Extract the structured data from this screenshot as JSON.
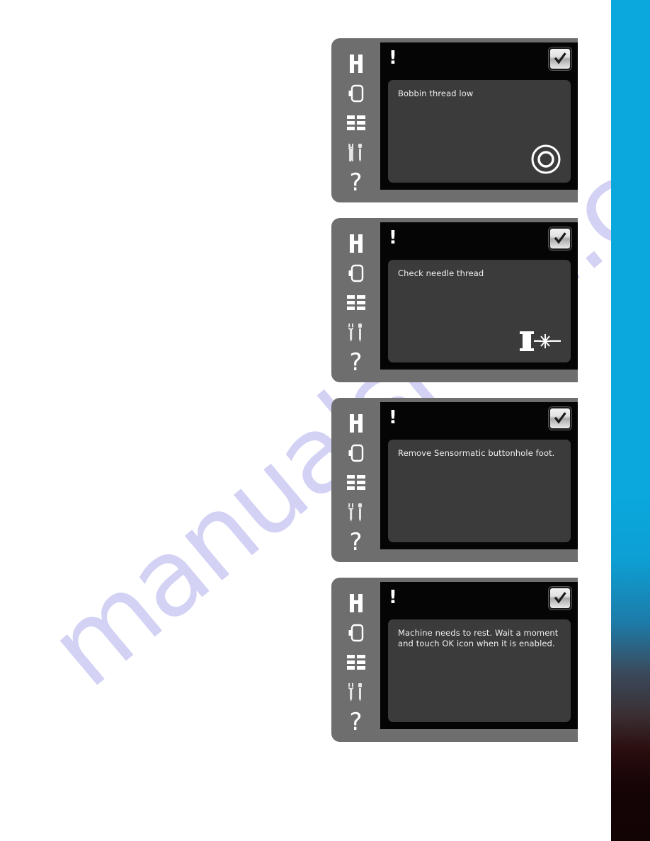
{
  "page": {
    "background_color": "#ffffff",
    "watermark_text": "manualshive.com",
    "watermark_color": "#b9b6ee"
  },
  "edge_strip": {
    "name": "page-edge-gradient",
    "top_color": "#0aa8dd",
    "mid_color": "#3a4a5c",
    "bottom_color": "#160406"
  },
  "sidebar": {
    "items": [
      {
        "icon": "presser-foot-icon",
        "label": ""
      },
      {
        "icon": "bobbin-case-icon",
        "label": ""
      },
      {
        "icon": "menu-grid-icon",
        "label": ""
      },
      {
        "icon": "tools-wrench-screwdriver-icon",
        "label": ""
      },
      {
        "icon": "help-question-mark-icon",
        "label": "?"
      }
    ]
  },
  "common": {
    "alert_marker": "!",
    "ok_button_label": "OK",
    "ok_icon": "checkmark-icon",
    "screen_background": "#050505",
    "message_box_background": "#3b3b3b",
    "panel_background": "#6e6e6e"
  },
  "panels": [
    {
      "id": "popup-bobbin-thread-low",
      "alert": "!",
      "message": "Bobbin thread low",
      "graphic": "bobbin-icon"
    },
    {
      "id": "popup-check-needle-thread",
      "alert": "!",
      "message": "Check needle thread",
      "graphic": "broken-needle-thread-icon"
    },
    {
      "id": "popup-remove-sensormatic-buttonhole-foot",
      "alert": "!",
      "message": "Remove Sensormatic buttonhole foot.",
      "graphic": "none"
    },
    {
      "id": "popup-machine-needs-to-rest",
      "alert": "!",
      "message": "Machine needs to rest. Wait a moment and touch OK icon when it is enabled.",
      "graphic": "none"
    }
  ]
}
